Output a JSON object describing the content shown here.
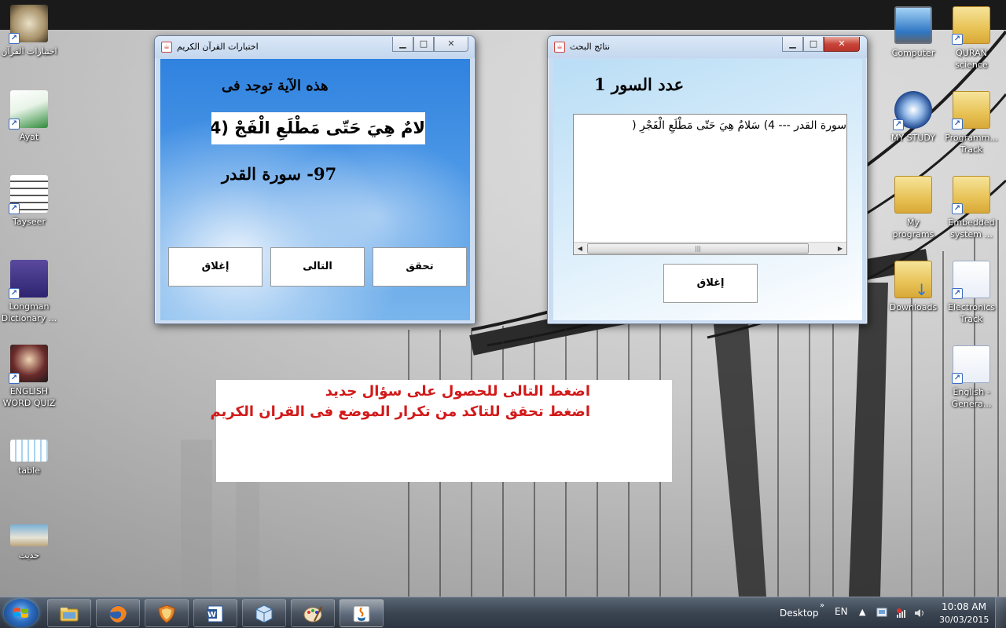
{
  "desktop": {
    "icons_left": [
      {
        "label": "اختبارات القرآن",
        "icon": "quran-app-icon"
      },
      {
        "label": "Ayat",
        "icon": "ayat-app-icon"
      },
      {
        "label": "Tayseer",
        "icon": "tayseer-app-icon"
      },
      {
        "label": "Longman Dictionary ...",
        "icon": "longman-dictionary-icon"
      },
      {
        "label": "ENGLISH WORD QUIZ",
        "icon": "english-quiz-icon"
      },
      {
        "label": "table",
        "icon": "table-image-icon"
      },
      {
        "label": "حديث",
        "icon": "hadith-image-icon"
      }
    ],
    "icons_right": [
      {
        "label": "Computer",
        "icon": "computer-icon"
      },
      {
        "label": "QURAN science",
        "icon": "folder-icon"
      },
      {
        "label": "MY STUDY",
        "icon": "my-study-icon"
      },
      {
        "label": "Programm... Track",
        "icon": "folder-icon"
      },
      {
        "label": "My programs",
        "icon": "folder-icon"
      },
      {
        "label": "Embedded system ...",
        "icon": "folder-icon"
      },
      {
        "label": "Downloads",
        "icon": "downloads-folder-icon"
      },
      {
        "label": "Electronics Track",
        "icon": "folder-icon"
      },
      {
        "label": "English - Genera...",
        "icon": "document-icon"
      }
    ]
  },
  "quran_window": {
    "title": "اختبارات القرآن الكريم",
    "heading": "هذه الآية توجد فى",
    "verse": "لامٌ هِيَ حَتّى مَطْلَعِ الْفَجْ (4",
    "surah": "97- سورة القدر",
    "buttons": {
      "close": "إغلاق",
      "next": "التالى",
      "check": "تحقق"
    }
  },
  "results_window": {
    "title": "نتائج البحث",
    "count_label": "عدد السور 1",
    "result_line": "سورة القدر --- 4) سَلامٌ هِيَ حَتّى مَطْلَعِ الْفَجْرِ (",
    "close_button": "إغلاق"
  },
  "instructions": {
    "line1": "اضغط التالى للحصول على سؤال جديد",
    "line2": "اضغط تحقق للتاكد من تكرار الموضع فى القران الكريم"
  },
  "taskbar": {
    "apps": [
      {
        "name": "file-explorer",
        "icon": "folder-icon"
      },
      {
        "name": "firefox",
        "icon": "firefox-icon"
      },
      {
        "name": "security",
        "icon": "shield-icon"
      },
      {
        "name": "word",
        "icon": "word-icon"
      },
      {
        "name": "virtualbox",
        "icon": "cube-icon"
      },
      {
        "name": "paint",
        "icon": "palette-icon"
      },
      {
        "name": "java",
        "icon": "java-icon"
      }
    ],
    "desktop_label": "Desktop",
    "chevron": "»",
    "language": "EN",
    "time": "10:08 AM",
    "date": "30/03/2015"
  }
}
